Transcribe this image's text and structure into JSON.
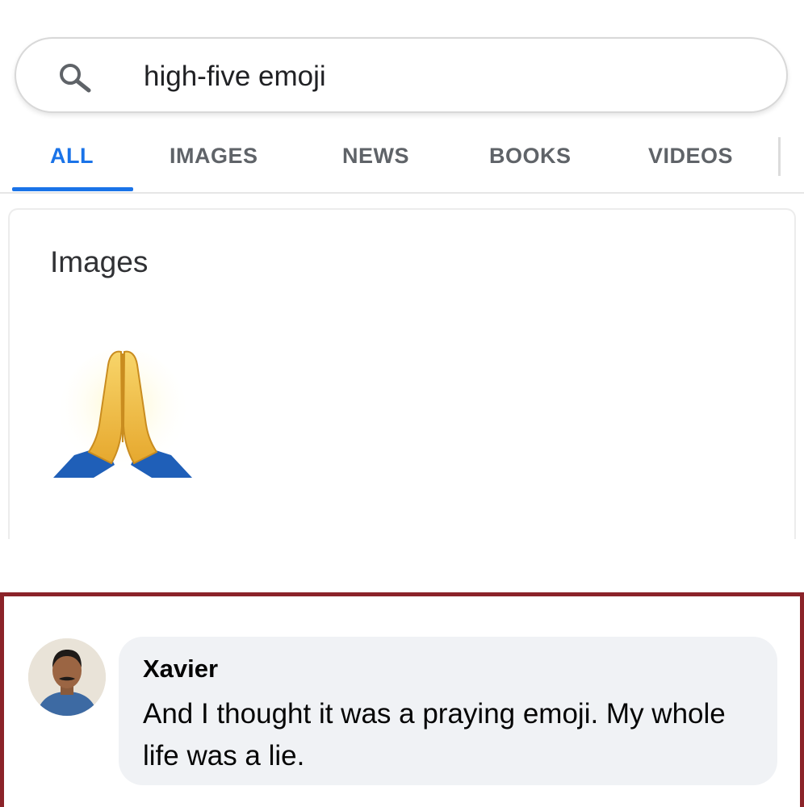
{
  "search": {
    "query": "high-five emoji"
  },
  "tabs": [
    {
      "label": "ALL",
      "active": true
    },
    {
      "label": "IMAGES",
      "active": false
    },
    {
      "label": "NEWS",
      "active": false
    },
    {
      "label": "BOOKS",
      "active": false
    },
    {
      "label": "VIDEOS",
      "active": false
    }
  ],
  "images_section": {
    "heading": "Images",
    "result_icon": "folded-hands-icon"
  },
  "comment": {
    "author": "Xavier",
    "text": "And I thought it was a praying emoji. My whole life was a lie."
  },
  "colors": {
    "accent": "#1a73e8",
    "tab_text": "#5f6368",
    "comment_border": "#8b2329",
    "bubble_bg": "#f0f2f5",
    "emoji_skin": "#f4c04a",
    "emoji_sleeve": "#1f5fb8"
  }
}
